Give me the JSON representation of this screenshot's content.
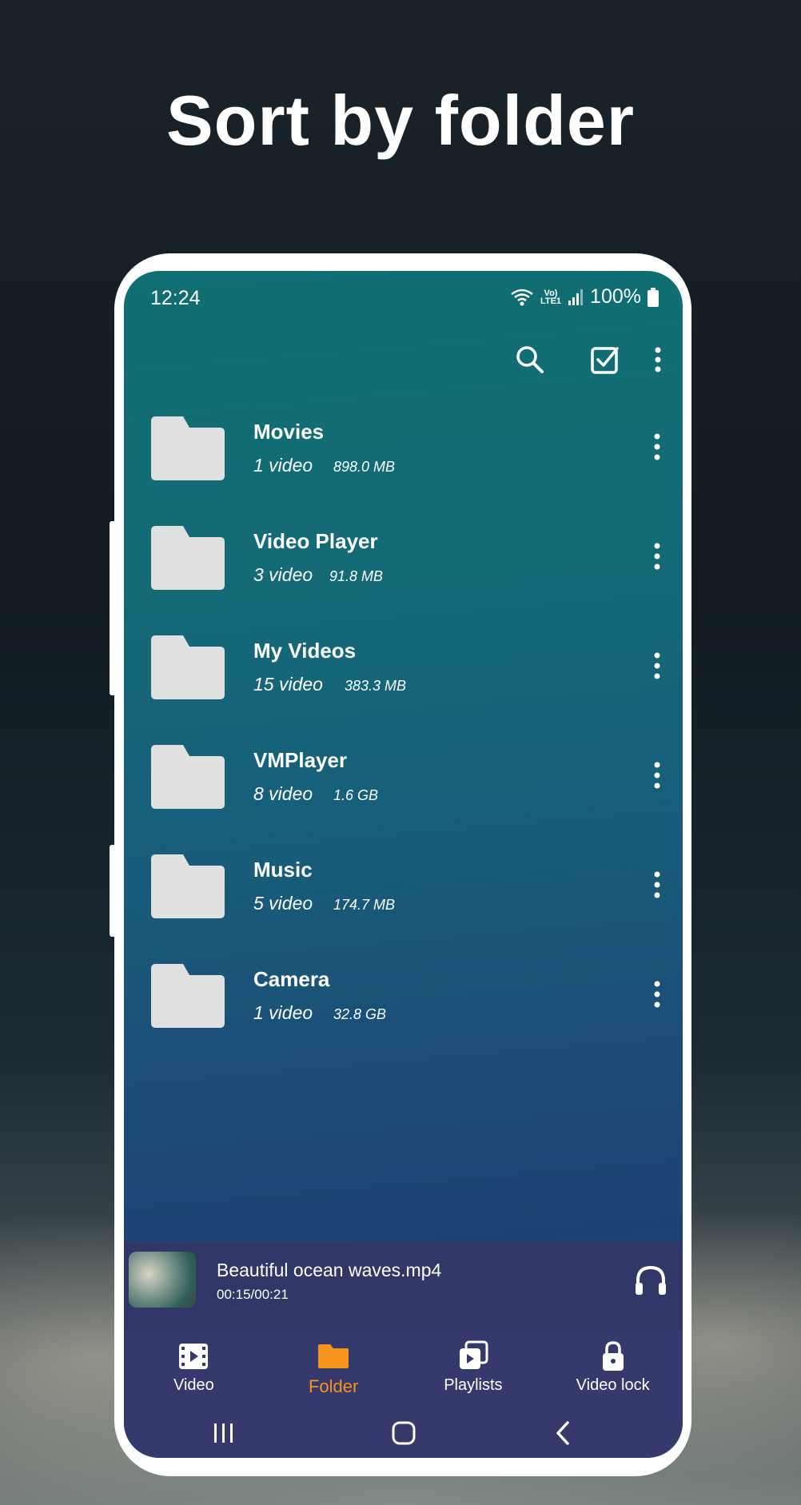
{
  "headline": "Sort by folder",
  "status": {
    "time": "12:24",
    "volte_top": "Vo)",
    "volte_bottom": "LTE1",
    "battery": "100%"
  },
  "toolbar": {
    "icons": [
      "search-icon",
      "select-check-icon",
      "more-vert-icon"
    ]
  },
  "folders": [
    {
      "name": "Movies",
      "count": "1 video",
      "size": "898.0 MB"
    },
    {
      "name": "Video Player",
      "count": "3 video",
      "size": "91.8 MB"
    },
    {
      "name": "My Videos",
      "count": "15 video",
      "size": "383.3 MB"
    },
    {
      "name": "VMPlayer",
      "count": "8 video",
      "size": "1.6 GB"
    },
    {
      "name": "Music",
      "count": "5 video",
      "size": "174.7 MB"
    },
    {
      "name": "Camera",
      "count": "1 video",
      "size": "32.8 GB"
    }
  ],
  "now_playing": {
    "title": "Beautiful ocean waves.mp4",
    "time": "00:15/00:21"
  },
  "nav": [
    {
      "label": "Video",
      "icon": "film-icon",
      "active": false
    },
    {
      "label": "Folder",
      "icon": "folder-icon",
      "active": true
    },
    {
      "label": "Playlists",
      "icon": "playlist-icon",
      "active": false
    },
    {
      "label": "Video lock",
      "icon": "lock-icon",
      "active": false
    }
  ],
  "colors": {
    "accent": "#f7941d",
    "nav_bg": "#35396b",
    "player_bg": "#313766",
    "folder_icon": "#e0e0e0"
  }
}
